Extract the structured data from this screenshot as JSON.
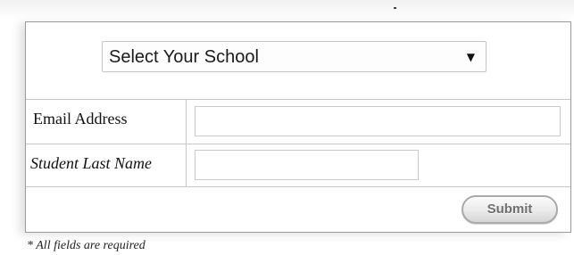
{
  "form": {
    "school_select": {
      "selected_value": "Select Your School",
      "caret_icon": "▼"
    },
    "email": {
      "label": "Email Address",
      "value": "",
      "placeholder": ""
    },
    "last_name": {
      "label": "Student Last Name",
      "value": "",
      "placeholder": ""
    },
    "submit_label": "Submit"
  },
  "required_note": "* All fields are required",
  "icons": {
    "caret": "chevron-down-icon"
  },
  "colors": {
    "border": "#9a9a9a",
    "row_divider": "#c6c6c6",
    "submit_text": "#6f6f6f"
  }
}
